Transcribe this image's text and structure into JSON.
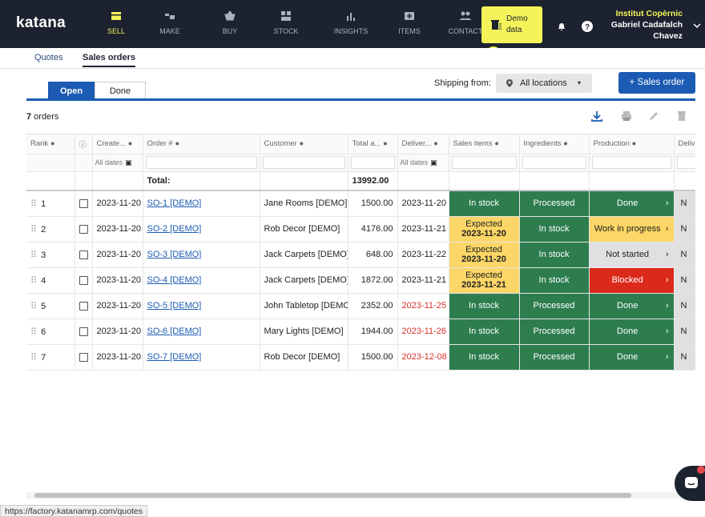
{
  "app": {
    "logo": "katana"
  },
  "nav": [
    {
      "label": "SELL",
      "icon": "sell-icon",
      "active": true
    },
    {
      "label": "MAKE",
      "icon": "make-icon",
      "active": false
    },
    {
      "label": "BUY",
      "icon": "buy-icon",
      "active": false
    },
    {
      "label": "STOCK",
      "icon": "stock-icon",
      "active": false
    },
    {
      "label": "INSIGHTS",
      "icon": "insights-icon",
      "active": false
    },
    {
      "label": "ITEMS",
      "icon": "items-icon",
      "active": false
    },
    {
      "label": "CONTACT",
      "icon": "contacts-icon",
      "active": false
    }
  ],
  "demo": {
    "label_line1": "Demo",
    "label_line2": "data",
    "plus": "+"
  },
  "company": {
    "name": "Institut Copèrnic",
    "user_line1": "Gabriel Cadafalch",
    "user_line2": "Chavez"
  },
  "subtabs": {
    "quotes": "Quotes",
    "sales_orders": "Sales orders"
  },
  "filters": {
    "open": "Open",
    "done": "Done"
  },
  "shipping": {
    "label": "Shipping from:",
    "location": "All locations"
  },
  "actions": {
    "sales_order": "+  Sales order"
  },
  "orders": {
    "count": "7",
    "suffix": " orders"
  },
  "columns": {
    "rank": "Rank",
    "created": "Create...",
    "order": "Order #",
    "customer": "Customer",
    "total": "Total a...",
    "delivery": "Deliver...",
    "sales_items": "Sales items",
    "ingredients": "Ingredients",
    "production": "Production",
    "delivery2": "Deliv"
  },
  "filter_row": {
    "created": "All dates",
    "delivery": "All dates"
  },
  "totals": {
    "label": "Total:",
    "value": "13992.00"
  },
  "rows": [
    {
      "rank": "1",
      "created": "2023-11-20",
      "order": "SO-1 [DEMO]",
      "customer": "Jane Rooms [DEMO]",
      "total": "1500.00",
      "delivery": "2023-11-20",
      "delivery_late": false,
      "sales": "In stock",
      "sales2": "",
      "sales_color": "green",
      "ingredients": "Processed",
      "ing_color": "green",
      "production": "Done",
      "prod_color": "green",
      "last": "N"
    },
    {
      "rank": "2",
      "created": "2023-11-20",
      "order": "SO-2 [DEMO]",
      "customer": "Rob Decor [DEMO]",
      "total": "4176.00",
      "delivery": "2023-11-21",
      "delivery_late": false,
      "sales": "Expected",
      "sales2": "2023-11-20",
      "sales_color": "yellow",
      "ingredients": "In stock",
      "ing_color": "green",
      "production": "Work in progress",
      "prod_color": "yellow",
      "last": "N"
    },
    {
      "rank": "3",
      "created": "2023-11-20",
      "order": "SO-3 [DEMO]",
      "customer": "Jack Carpets [DEMO]",
      "total": "648.00",
      "delivery": "2023-11-22",
      "delivery_late": false,
      "sales": "Expected",
      "sales2": "2023-11-20",
      "sales_color": "yellow",
      "ingredients": "In stock",
      "ing_color": "green",
      "production": "Not started",
      "prod_color": "grey",
      "last": "N"
    },
    {
      "rank": "4",
      "created": "2023-11-20",
      "order": "SO-4 [DEMO]",
      "customer": "Jack Carpets [DEMO]",
      "total": "1872.00",
      "delivery": "2023-11-21",
      "delivery_late": false,
      "sales": "Expected",
      "sales2": "2023-11-21",
      "sales_color": "yellow",
      "ingredients": "In stock",
      "ing_color": "green",
      "production": "Blocked",
      "prod_color": "red",
      "last": "N"
    },
    {
      "rank": "5",
      "created": "2023-11-20",
      "order": "SO-5 [DEMO]",
      "customer": "John Tabletop [DEMO",
      "total": "2352.00",
      "delivery": "2023-11-25",
      "delivery_late": true,
      "sales": "In stock",
      "sales2": "",
      "sales_color": "green",
      "ingredients": "Processed",
      "ing_color": "green",
      "production": "Done",
      "prod_color": "green",
      "last": "N"
    },
    {
      "rank": "6",
      "created": "2023-11-20",
      "order": "SO-6 [DEMO]",
      "customer": "Mary Lights [DEMO]",
      "total": "1944.00",
      "delivery": "2023-11-26",
      "delivery_late": true,
      "sales": "In stock",
      "sales2": "",
      "sales_color": "green",
      "ingredients": "Processed",
      "ing_color": "green",
      "production": "Done",
      "prod_color": "green",
      "last": "N"
    },
    {
      "rank": "7",
      "created": "2023-11-20",
      "order": "SO-7 [DEMO]",
      "customer": "Rob Decor [DEMO]",
      "total": "1500.00",
      "delivery": "2023-12-08",
      "delivery_late": true,
      "sales": "In stock",
      "sales2": "",
      "sales_color": "green",
      "ingredients": "Processed",
      "ing_color": "green",
      "production": "Done",
      "prod_color": "green",
      "last": "N"
    }
  ],
  "status_bar": {
    "url": "https://factory.katanamrp.com/quotes"
  },
  "colors": {
    "topbar": "#1d2230",
    "accent_yellow": "#f4f35a",
    "primary_blue": "#1c5bb3",
    "status_green": "#2e7d4f",
    "status_yellow": "#fcd666",
    "status_red": "#dc2a1a",
    "late_red": "#d8312b"
  }
}
